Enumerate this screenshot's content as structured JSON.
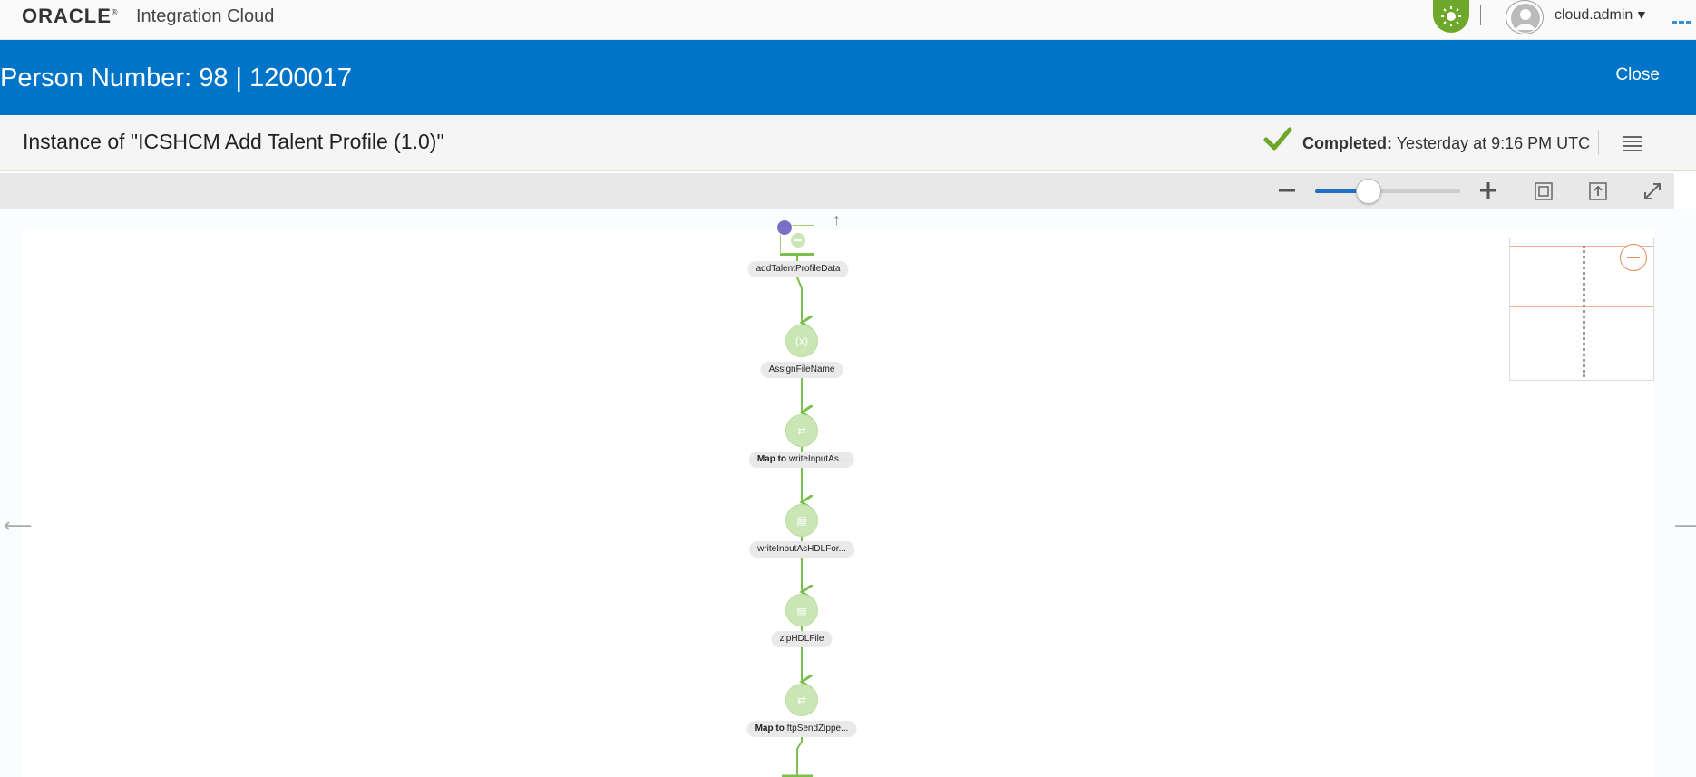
{
  "topbar": {
    "logo_text": "ORACLE",
    "product_name": "Integration Cloud",
    "user_name": "cloud.admin",
    "user_caret": "▼"
  },
  "header": {
    "title": "Person Number: 98 | 1200017",
    "close_label": "Close"
  },
  "instance": {
    "title": "Instance of \"ICSHCM Add Talent Profile (1.0)\"",
    "status_label": "Completed:",
    "status_time": "Yesterday at 9:16 PM UTC"
  },
  "toolbar": {
    "zoom_level_fraction": 0.37
  },
  "flow": {
    "trigger": {
      "label": "addTalentProfileData"
    },
    "nodes": [
      {
        "label_bold": "",
        "label": "AssignFileName",
        "icon": "variable-icon"
      },
      {
        "label_bold": "Map to",
        "label": "writeInputAs...",
        "icon": "map-icon"
      },
      {
        "label_bold": "",
        "label": "writeInputAsHDLFor...",
        "icon": "file-icon"
      },
      {
        "label_bold": "",
        "label": "zipHDLFile",
        "icon": "file-icon"
      },
      {
        "label_bold": "Map to",
        "label": "ftpSendZippe...",
        "icon": "map-icon"
      }
    ]
  },
  "colors": {
    "brand_blue": "#0074c8",
    "success_green": "#6ea82b",
    "flow_green": "#7bbf4f"
  }
}
